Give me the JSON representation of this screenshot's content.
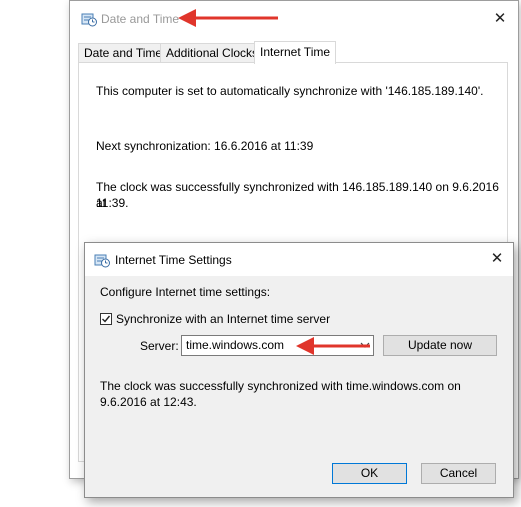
{
  "outer_window": {
    "title": "Date and Time",
    "tabs": [
      {
        "label": "Date and Time",
        "active": false
      },
      {
        "label": "Additional Clocks",
        "active": false
      },
      {
        "label": "Internet Time",
        "active": true
      }
    ],
    "sync_status": "This computer is set to automatically synchronize with '146.185.189.140'.",
    "next_sync": "Next synchronization: 16.6.2016 at 11:39",
    "last_result_line1": "The clock was successfully synchronized with 146.185.189.140 on 9.6.2016 at",
    "last_result_line2": "11:39."
  },
  "dialog": {
    "title": "Internet Time Settings",
    "heading": "Configure Internet time settings:",
    "sync_checkbox_label": "Synchronize with an Internet time server",
    "sync_checkbox_checked": true,
    "server_label": "Server:",
    "server_value": "time.windows.com",
    "update_button": "Update now",
    "result_line1": "The clock was successfully synchronized with time.windows.com on",
    "result_line2": "9.6.2016 at 12:43.",
    "ok_button": "OK",
    "cancel_button": "Cancel"
  },
  "colors": {
    "annotation_arrow": "#e0352b",
    "button_focus": "#0078d7",
    "dialog_bg": "#f0f0f0"
  },
  "icons": [
    "clock-settings-icon",
    "close-icon",
    "chevron-down-icon",
    "checkmark-icon",
    "red-arrow-annotation"
  ]
}
